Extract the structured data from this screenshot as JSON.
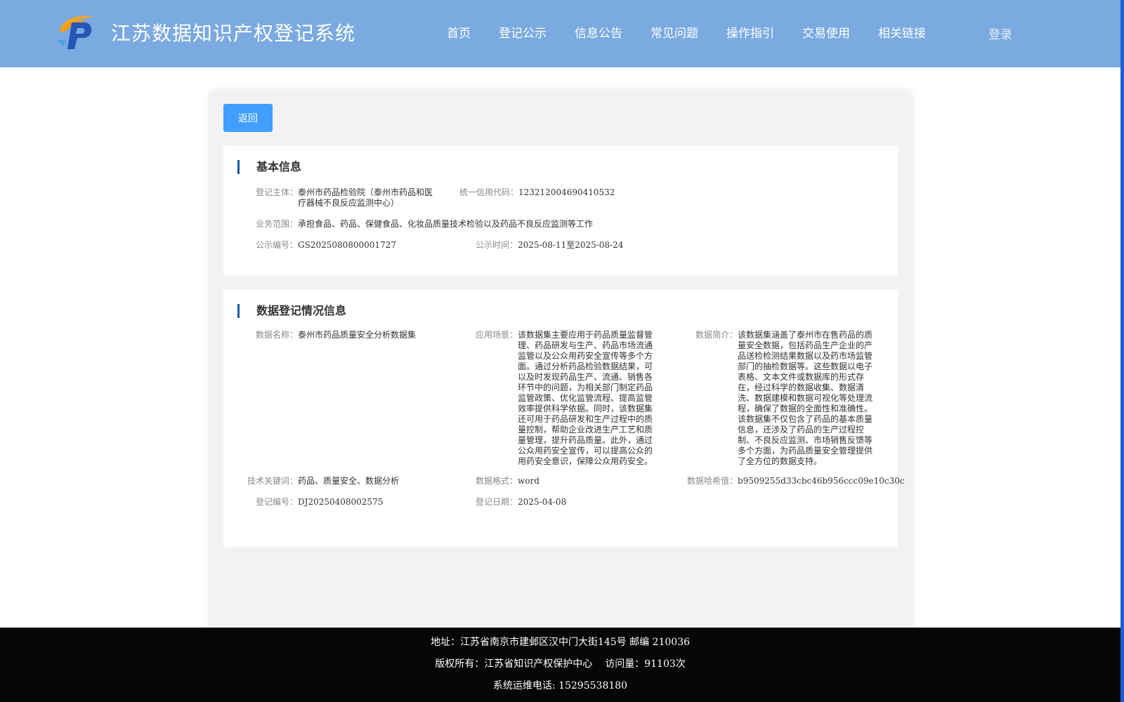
{
  "header": {
    "title": "江苏数据知识产权登记系统",
    "nav": [
      "首页",
      "登记公示",
      "信息公告",
      "常见问题",
      "操作指引",
      "交易使用",
      "相关链接"
    ],
    "login": "登录"
  },
  "back_label": "返回",
  "basic": {
    "title": "基本信息",
    "entity_label": "登记主体：",
    "entity_value": "泰州市药品检验院（泰州市药品和医疗器械不良反应监测中心）",
    "credit_label": "统一信用代码：",
    "credit_value": "123212004690410532",
    "scope_label": "业务范围：",
    "scope_value": "承担食品、药品、保健食品、化妆品质量技术检验以及药品不良反应监测等工作",
    "pub_no_label": "公示编号：",
    "pub_no_value": "GS2025080800001727",
    "pub_time_label": "公示时间：",
    "pub_time_value": "2025-08-11至2025-08-24"
  },
  "data_reg": {
    "title": "数据登记情况信息",
    "name_label": "数据名称：",
    "name_value": "泰州市药品质量安全分析数据集",
    "scene_label": "应用场景：",
    "scene_value": "该数据集主要应用于药品质量监督管理、药品研发与生产、药品市场流通监管以及公众用药安全宣传等多个方面。通过分析药品检验数据结果，可以及时发现药品生产、流通、销售各环节中的问题，为相关部门制定药品监管政策、优化监管流程、提高监管效率提供科学依据。同时，该数据集还可用于药品研发和生产过程中的质量控制，帮助企业改进生产工艺和质量管理，提升药品质量。此外，通过公众用药安全宣传，可以提高公众的用药安全意识，保障公众用药安全。",
    "intro_label": "数据简介：",
    "intro_value": "该数据集涵盖了泰州市在售药品的质量安全数据，包括药品生产企业的产品送检检测结果数据以及药市场监管部门的抽检数据等。这些数据以电子表格、文本文件或数据库的形式存在，经过科学的数据收集、数据清洗、数据建模和数据可视化等处理流程，确保了数据的全面性和准确性。该数据集不仅包含了药品的基本质量信息，还涉及了药品的生产过程控制、不良反应监测、市场销售反馈等多个方面，为药品质量安全管理提供了全方位的数据支持。",
    "keyword_label": "技术关键词：",
    "keyword_value": "药品、质量安全、数据分析",
    "format_label": "数据格式：",
    "format_value": "word",
    "hash_label": "数据哈希值：",
    "hash_value": "b9509255d33cbc46b956ccc09e10c30c",
    "reg_no_label": "登记编号：",
    "reg_no_value": "DJ20250408002575",
    "reg_date_label": "登记日期：",
    "reg_date_value": "2025-04-08"
  },
  "footer": {
    "address": "地址：江苏省南京市建邺区汉中门大街145号 邮编 210036",
    "copyright": "版权所有：江苏省知识产权保护中心",
    "visits": "访问量：91103次",
    "phone": "系统运维电话: 15295538180"
  },
  "colors": {
    "header_bg": "#7aaadf",
    "button": "#409eff",
    "section_bar": "#1d5aa8",
    "footer_bg": "#060606"
  }
}
